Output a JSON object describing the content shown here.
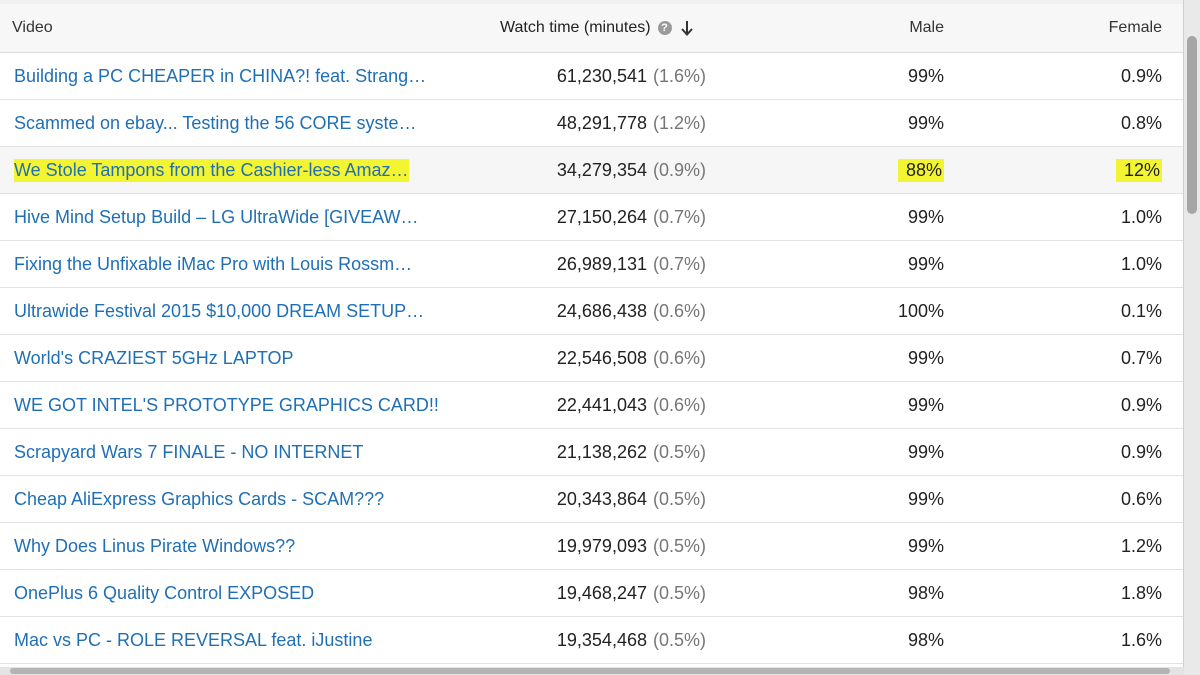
{
  "columns": {
    "video": "Video",
    "watch_time": "Watch time (minutes)",
    "male": "Male",
    "female": "Female"
  },
  "icons": {
    "help": "help-circle-icon",
    "sort": "arrow-down-icon"
  },
  "highlight_color": "#f4f532",
  "link_color": "#1f6fb5",
  "rows": [
    {
      "title": "Building a PC CHEAPER in CHINA?! feat. Strang…",
      "watch": "61,230,541",
      "share": "(1.6%)",
      "male": "99%",
      "female": "0.9%"
    },
    {
      "title": "Scammed on ebay... Testing the 56 CORE syste…",
      "watch": "48,291,778",
      "share": "(1.2%)",
      "male": "99%",
      "female": "0.8%"
    },
    {
      "title": "We Stole Tampons from the Cashier-less Amaz…",
      "watch": "34,279,354",
      "share": "(0.9%)",
      "male": "88%",
      "female": "12%",
      "highlighted": true
    },
    {
      "title": "Hive Mind Setup Build – LG UltraWide [GIVEAW…",
      "watch": "27,150,264",
      "share": "(0.7%)",
      "male": "99%",
      "female": "1.0%"
    },
    {
      "title": "Fixing the Unfixable iMac Pro with Louis Rossm…",
      "watch": "26,989,131",
      "share": "(0.7%)",
      "male": "99%",
      "female": "1.0%"
    },
    {
      "title": "Ultrawide Festival 2015 $10,000 DREAM SETUP…",
      "watch": "24,686,438",
      "share": "(0.6%)",
      "male": "100%",
      "female": "0.1%"
    },
    {
      "title": "World's CRAZIEST 5GHz LAPTOP",
      "watch": "22,546,508",
      "share": "(0.6%)",
      "male": "99%",
      "female": "0.7%"
    },
    {
      "title": "WE GOT INTEL'S PROTOTYPE GRAPHICS CARD!!",
      "watch": "22,441,043",
      "share": "(0.6%)",
      "male": "99%",
      "female": "0.9%"
    },
    {
      "title": "Scrapyard Wars 7 FINALE - NO INTERNET",
      "watch": "21,138,262",
      "share": "(0.5%)",
      "male": "99%",
      "female": "0.9%"
    },
    {
      "title": "Cheap AliExpress Graphics Cards - SCAM???",
      "watch": "20,343,864",
      "share": "(0.5%)",
      "male": "99%",
      "female": "0.6%"
    },
    {
      "title": "Why Does Linus Pirate Windows??",
      "watch": "19,979,093",
      "share": "(0.5%)",
      "male": "99%",
      "female": "1.2%"
    },
    {
      "title": "OnePlus 6 Quality Control EXPOSED",
      "watch": "19,468,247",
      "share": "(0.5%)",
      "male": "98%",
      "female": "1.8%"
    },
    {
      "title": "Mac vs PC - ROLE REVERSAL feat. iJustine",
      "watch": "19,354,468",
      "share": "(0.5%)",
      "male": "98%",
      "female": "1.6%"
    }
  ]
}
